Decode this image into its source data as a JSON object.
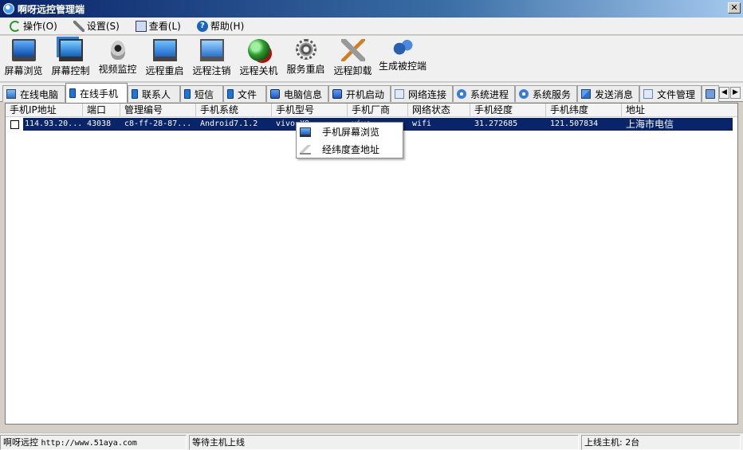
{
  "window": {
    "title": "啊呀远控管理端",
    "close_label": "✕"
  },
  "menu": [
    {
      "label": "操作(O)",
      "icon": "refresh-icon"
    },
    {
      "label": "设置(S)",
      "icon": "tools-icon"
    },
    {
      "label": "查看(L)",
      "icon": "view-icon"
    },
    {
      "label": "帮助(H)",
      "icon": "help-icon"
    }
  ],
  "toolbar": [
    {
      "label": "屏幕浏览",
      "icon": "monitor-icon"
    },
    {
      "label": "屏幕控制",
      "icon": "screens-icon"
    },
    {
      "label": "视频监控",
      "icon": "webcam-icon"
    },
    {
      "label": "远程重启",
      "icon": "restart-icon"
    },
    {
      "label": "远程注销",
      "icon": "logoff-icon"
    },
    {
      "label": "远程关机",
      "icon": "shutdown-globe-icon"
    },
    {
      "label": "服务重启",
      "icon": "gear-icon"
    },
    {
      "label": "远程卸载",
      "icon": "wrench-icon"
    },
    {
      "label": "生成被控端",
      "icon": "gears-icon"
    }
  ],
  "tabs": [
    {
      "label": "在线电脑",
      "icon": "pc",
      "active": false
    },
    {
      "label": "在线手机",
      "icon": "phone",
      "active": true
    },
    {
      "label": "联系人",
      "icon": "phone",
      "active": false
    },
    {
      "label": "短信",
      "icon": "phone",
      "active": false
    },
    {
      "label": "文件",
      "icon": "phone",
      "active": false
    },
    {
      "label": "电脑信息",
      "icon": "net",
      "active": false
    },
    {
      "label": "开机启动",
      "icon": "net",
      "active": false
    },
    {
      "label": "网络连接",
      "icon": "doc",
      "active": false
    },
    {
      "label": "系统进程",
      "icon": "gear",
      "active": false
    },
    {
      "label": "系统服务",
      "icon": "gear",
      "active": false
    },
    {
      "label": "发送消息",
      "icon": "mail",
      "active": false
    },
    {
      "label": "文件管理",
      "icon": "doc",
      "active": false
    },
    {
      "label": "",
      "icon": "folder",
      "active": false
    }
  ],
  "table": {
    "columns": [
      "手机IP地址",
      "端口",
      "管理编号",
      "手机系统",
      "手机型号",
      "手机厂商",
      "网络状态",
      "手机经度",
      "手机纬度",
      "地址"
    ],
    "rows": [
      {
        "checked": false,
        "cells": [
          "114.93.20...",
          "43038",
          "c8-ff-28-87...",
          "Android7.1.2",
          "vivo X9",
          "vivo",
          "wifi",
          "31.272685",
          "121.507834",
          "上海市电信"
        ]
      }
    ]
  },
  "context_menu": {
    "items": [
      {
        "label": "手机屏幕浏览",
        "icon": "phone-screen-icon"
      },
      {
        "label": "经纬度查地址",
        "icon": "pen-icon"
      }
    ]
  },
  "statusbar": {
    "app": "啊呀远控",
    "url": "http://www.51aya.com",
    "status": "等待主机上线",
    "online": "上线主机: 2台"
  }
}
